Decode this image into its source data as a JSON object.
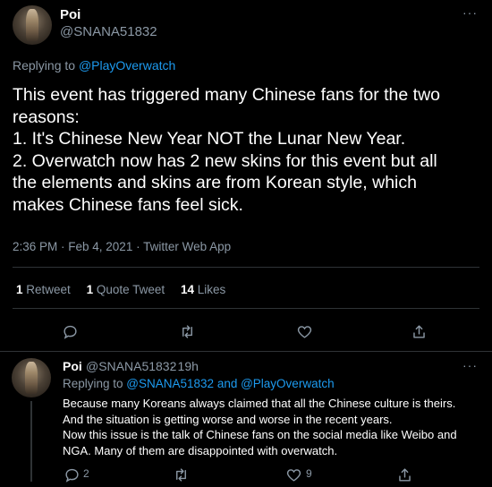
{
  "main_tweet": {
    "name": "Poi",
    "handle": "@SNANA51832",
    "more": "···",
    "replying_prefix": "Replying to ",
    "replying_to": "@PlayOverwatch",
    "lines": [
      "This event has triggered many Chinese fans for the two",
      "reasons:",
      "1. It's Chinese New Year NOT the Lunar New Year.",
      "2. Overwatch now has 2 new skins for this event but all",
      "the elements and skins are from Korean style, which",
      "makes Chinese fans feel sick."
    ],
    "meta": "2:36 PM · Feb 4, 2021 · Twitter Web App",
    "stats": {
      "retweets_count": "1",
      "retweets_label": "Retweet",
      "quotes_count": "1",
      "quotes_label": "Quote Tweet",
      "likes_count": "14",
      "likes_label": "Likes"
    }
  },
  "reply_tweet": {
    "name": "Poi",
    "handle": "@SNANA51832",
    "time": "· 19h",
    "more": "···",
    "replying_prefix": "Replying to ",
    "replying_to_1": "@SNANA51832",
    "replying_and": " and ",
    "replying_to_2": "@PlayOverwatch",
    "lines": [
      "Because many Koreans always claimed that all the Chinese culture is theirs.",
      "And the situation is getting worse and worse in the recent years.",
      "Now this issue is the talk of Chinese fans on the social media like Weibo and",
      "NGA. Many of them are disappointed with overwatch."
    ],
    "reply_count": "2",
    "like_count": "9"
  },
  "icons": [
    "reply-icon",
    "retweet-icon",
    "like-icon",
    "share-icon",
    "more-icon"
  ],
  "colors": {
    "background": "#000000",
    "link": "#1d9bf0",
    "muted": "#8b98a5",
    "divider": "#2f3336"
  }
}
